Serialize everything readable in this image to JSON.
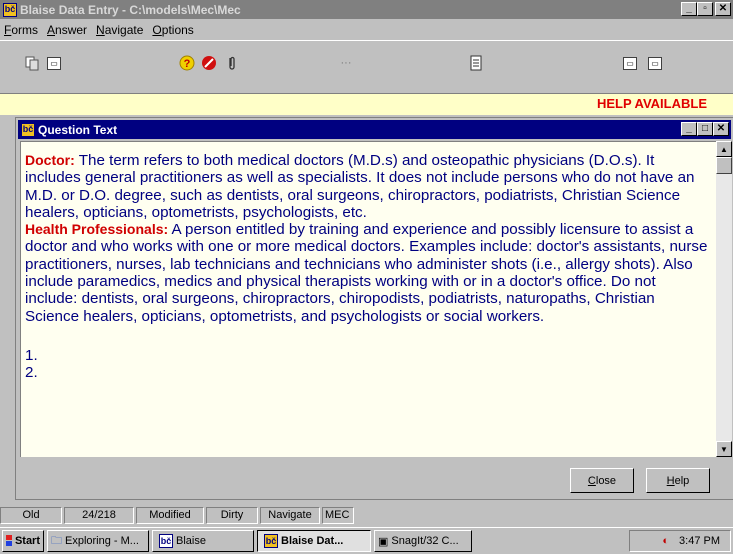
{
  "window": {
    "title": "Blaise Data Entry - C:\\models\\Mec\\Mec",
    "icon_text": "bč"
  },
  "menu": [
    "Forms",
    "Answer",
    "Navigate",
    "Options"
  ],
  "toolbar": {
    "icons": [
      "copy-icon",
      "window-icon",
      "help-question-icon",
      "stop-icon",
      "paperclip-icon",
      "dots-icon",
      "document-icon",
      "window-icon",
      "window-icon"
    ],
    "dots": "···"
  },
  "help_bar": {
    "text": "HELP AVAILABLE"
  },
  "question_window": {
    "title": "Question Text",
    "paragraphs": [
      {
        "term": "Doctor:",
        "text": " The term refers to both medical doctors (M.D.s) and osteopathic physicians (D.O.s). It includes general practitioners as well as specialists. It does not include persons who do not have an M.D. or D.O. degree, such as dentists, oral surgeons, chiropractors, podiatrists, Christian Science healers, opticians, optometrists, psychologists, etc."
      },
      {
        "term": "Health Professionals:",
        "text": " A person entitled by training and experience and possibly licensure to assist a doctor and who works with one or more medical doctors. Examples include: doctor's assistants, nurse practitioners, nurses, lab technicians and technicians who administer shots (i.e., allergy shots). Also include paramedics, medics and physical therapists working with or in a doctor's office. Do not include: dentists, oral surgeons, chiropractors, chiropodists, podiatrists, naturopaths, Christian Science healers, opticians, optometrists, and psychologists or social workers."
      }
    ],
    "options": [
      "1.",
      "2."
    ],
    "close_label": "Close",
    "help_label": "Help"
  },
  "status": [
    "Old",
    "24/218",
    "Modified",
    "Dirty",
    "Navigate",
    "MEC"
  ],
  "taskbar": {
    "start": "Start",
    "items": [
      "Exploring - M...",
      "Blaise",
      "Blaise Dat...",
      "SnagIt/32 C..."
    ],
    "time": "3:47 PM"
  }
}
